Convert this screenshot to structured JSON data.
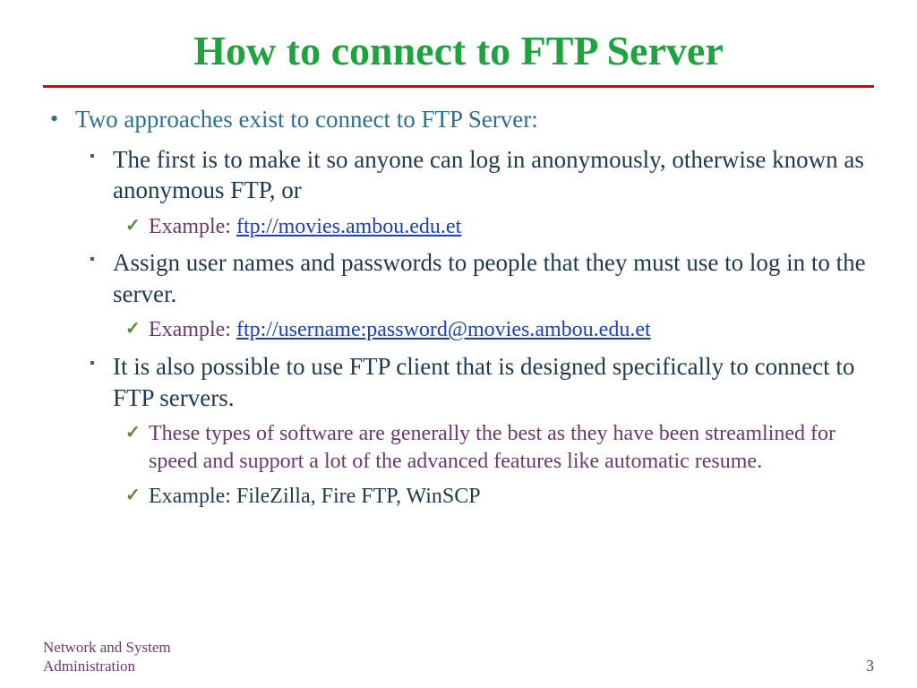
{
  "title": "How to connect to FTP Server",
  "main": {
    "intro": "Two approaches exist to connect to FTP Server:",
    "point1": {
      "text": "The first is to make it so anyone can log in anonymously, otherwise known as anonymous FTP, or",
      "example_label": "Example: ",
      "example_link": "ftp://movies.ambou.edu.et"
    },
    "point2": {
      "text": "Assign user names and passwords to people that they must use to log in to the server.",
      "example_label": "Example: ",
      "example_link": "ftp://username:password@movies.ambou.edu.et"
    },
    "point3": {
      "text": "It is also possible to use FTP client that is designed specifically to connect to FTP servers.",
      "sub1": "These types of software are generally the best as they have been streamlined for speed and support a lot of the advanced features like automatic resume.",
      "sub2": "Example: FileZilla, Fire FTP, WinSCP"
    }
  },
  "footer": {
    "left_line1": "Network and System",
    "left_line2": "Administration",
    "page": "3"
  }
}
